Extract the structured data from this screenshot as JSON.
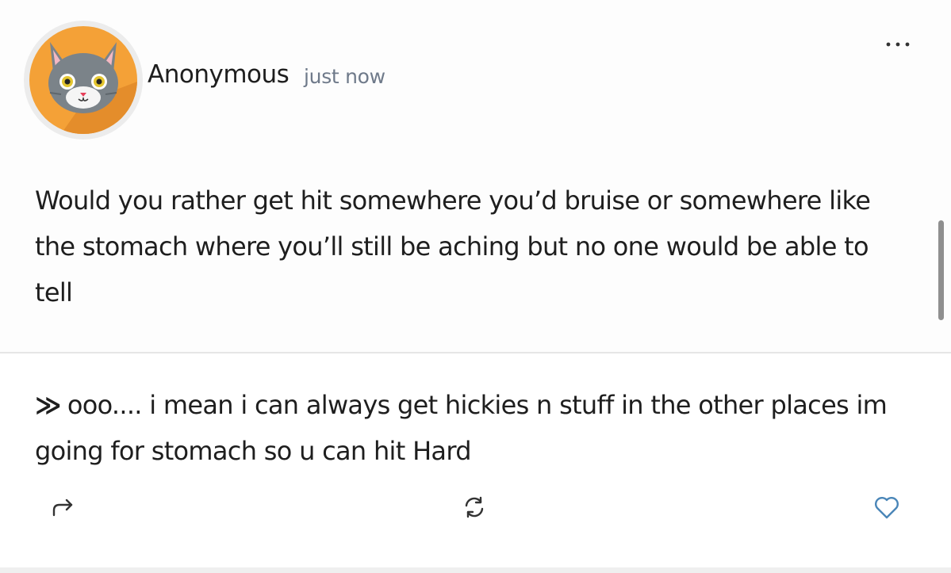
{
  "post": {
    "author": "Anonymous",
    "timestamp": "just now",
    "more_icon": "more-horizontal-icon",
    "question": "Would you rather get hit somewhere you’d bruise or somewhere like the stomach where you’ll still be aching but no one would be able to tell",
    "answer_marker": "≫",
    "answer": "ooo.... i mean i can always get hickies n stuff in the other places im going for stomach so u can hit Hard"
  },
  "actions": {
    "share_icon": "share-arrow-icon",
    "refresh_icon": "refresh-icon",
    "like_icon": "heart-icon"
  },
  "colors": {
    "avatar_bg": "#f4a137",
    "avatar_shadow": "#e48d2b",
    "cat_gray": "#7b8389",
    "cat_dark": "#5f676c",
    "cat_ear_inner": "#f4b8c2",
    "cat_eye": "#e3c530",
    "icon_gray": "#333333",
    "heart_blue": "#4a86b8",
    "timestamp": "#6f7a8a"
  }
}
